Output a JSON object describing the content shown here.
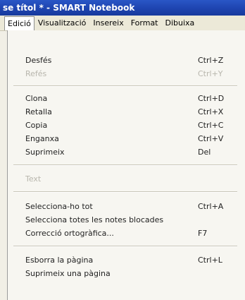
{
  "window": {
    "title": "se títol * - SMART Notebook"
  },
  "menubar": {
    "items": [
      "Edició",
      "Visualització",
      "Insereix",
      "Format",
      "Dibuixa"
    ]
  },
  "menu": {
    "undo": {
      "label": "Desfés",
      "shortcut": "Ctrl+Z"
    },
    "redo": {
      "label": "Refés",
      "shortcut": "Ctrl+Y"
    },
    "clone": {
      "label": "Clona",
      "shortcut": "Ctrl+D"
    },
    "cut": {
      "label": "Retalla",
      "shortcut": "Ctrl+X"
    },
    "copy": {
      "label": "Copia",
      "shortcut": "Ctrl+C"
    },
    "paste": {
      "label": "Enganxa",
      "shortcut": "Ctrl+V"
    },
    "delete": {
      "label": "Suprimeix",
      "shortcut": "Del"
    },
    "text": {
      "label": "Text"
    },
    "select_all": {
      "label": "Selecciona-ho tot",
      "shortcut": "Ctrl+A"
    },
    "select_locked": {
      "label": "Selecciona totes les notes blocades"
    },
    "spellcheck": {
      "label": "Correcció ortogràfica...",
      "shortcut": "F7"
    },
    "clear_page": {
      "label": "Esborra la pàgina",
      "shortcut": "Ctrl+L"
    },
    "delete_page": {
      "label": "Suprimeix una pàgina"
    }
  }
}
